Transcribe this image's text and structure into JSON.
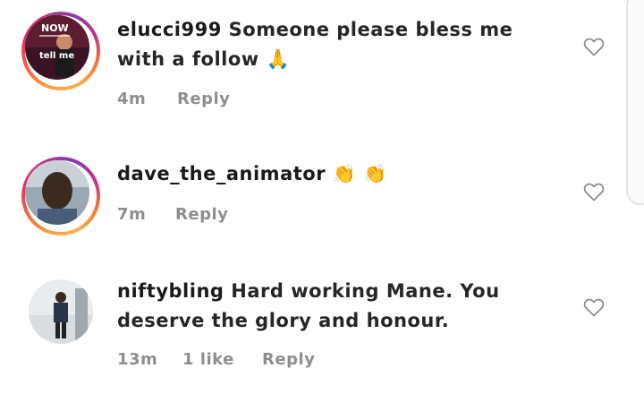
{
  "comments": [
    {
      "username": "elucci999",
      "text": "Someone please bless me with a follow 🙏",
      "time": "4m",
      "reply_label": "Reply",
      "likes": "",
      "avatar_text_top": "NOW",
      "avatar_text_bottom": "tell me"
    },
    {
      "username": "dave_the_animator",
      "text": "👏 👏",
      "time": "7m",
      "reply_label": "Reply",
      "likes": ""
    },
    {
      "username": "niftybling",
      "text": "Hard working Mane. You deserve the glory and honour.",
      "time": "13m",
      "reply_label": "Reply",
      "likes": "1 like"
    }
  ],
  "icons": {
    "like": "heart-outline-icon"
  },
  "colors": {
    "ring_gradient": [
      "#f9a03f",
      "#f56040",
      "#e1306c",
      "#c13584",
      "#833ab4"
    ],
    "meta_text": "#8e8e8e",
    "main_text": "#262626"
  }
}
